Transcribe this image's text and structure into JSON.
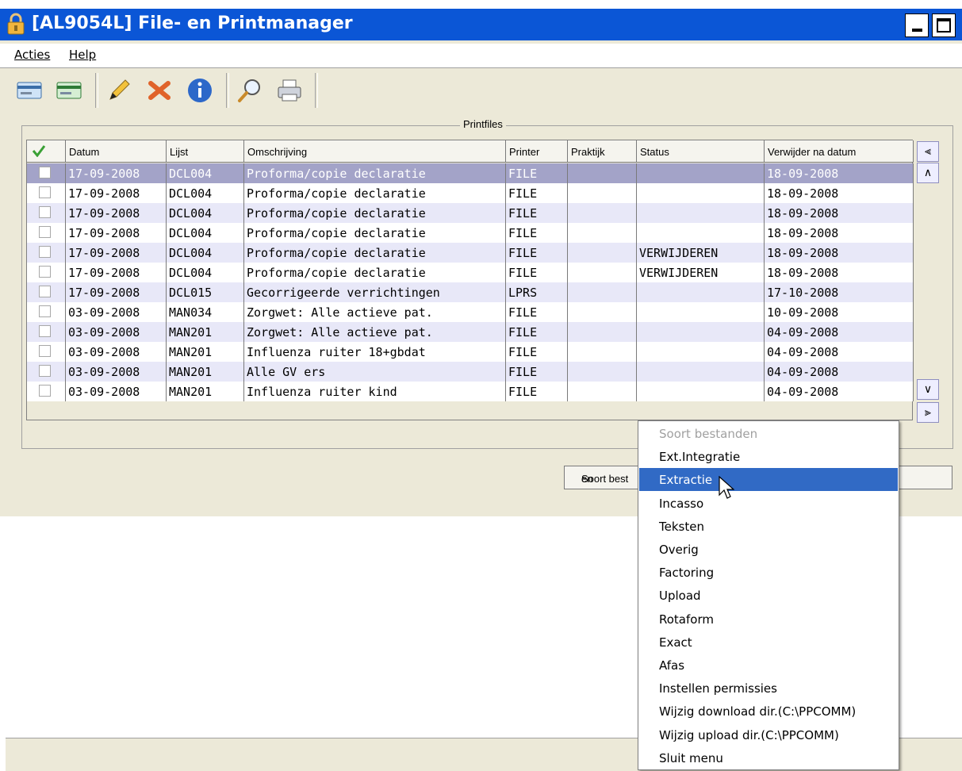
{
  "window": {
    "title": "[AL9054L] File- en Printmanager"
  },
  "menubar": {
    "items": [
      "Acties",
      "Help"
    ]
  },
  "toolbar": {
    "icons": [
      "card-icon",
      "card-green-icon",
      "pencil-icon",
      "delete-icon",
      "info-icon",
      "search-icon",
      "printer-icon"
    ]
  },
  "group": {
    "label": "Printfiles"
  },
  "grid": {
    "columns": [
      "",
      "Datum",
      "Lijst",
      "Omschrijving",
      "Printer",
      "Praktijk",
      "Status",
      "Verwijder na datum"
    ],
    "rows": [
      [
        "17-09-2008",
        "DCL004",
        "Proforma/copie declaratie",
        "FILE",
        "",
        "",
        "18-09-2008"
      ],
      [
        "17-09-2008",
        "DCL004",
        "Proforma/copie declaratie",
        "FILE",
        "",
        "",
        "18-09-2008"
      ],
      [
        "17-09-2008",
        "DCL004",
        "Proforma/copie declaratie",
        "FILE",
        "",
        "",
        "18-09-2008"
      ],
      [
        "17-09-2008",
        "DCL004",
        "Proforma/copie declaratie",
        "FILE",
        "",
        "",
        "18-09-2008"
      ],
      [
        "17-09-2008",
        "DCL004",
        "Proforma/copie declaratie",
        "FILE",
        "",
        "VERWIJDEREN",
        "18-09-2008"
      ],
      [
        "17-09-2008",
        "DCL004",
        "Proforma/copie declaratie",
        "FILE",
        "",
        "VERWIJDEREN",
        "18-09-2008"
      ],
      [
        "17-09-2008",
        "DCL015",
        "Gecorrigeerde verrichtingen",
        "LPRS",
        "",
        "",
        "17-10-2008"
      ],
      [
        "03-09-2008",
        "MAN034",
        "Zorgwet: Alle actieve pat.",
        "FILE",
        "",
        "",
        "10-09-2008"
      ],
      [
        "03-09-2008",
        "MAN201",
        "Zorgwet: Alle actieve pat.",
        "FILE",
        "",
        "",
        "04-09-2008"
      ],
      [
        "03-09-2008",
        "MAN201",
        "Influenza ruiter 18+gbdat",
        "FILE",
        "",
        "",
        "04-09-2008"
      ],
      [
        "03-09-2008",
        "MAN201",
        "Alle GV ers",
        "FILE",
        "",
        "",
        "04-09-2008"
      ],
      [
        "03-09-2008",
        "MAN201",
        "Influenza ruiter kind",
        "FILE",
        "",
        "",
        "04-09-2008"
      ]
    ]
  },
  "buttons": {
    "soort_left": "Soort best",
    "soort_right": "en"
  },
  "context_menu": {
    "items": [
      {
        "label": "Soort bestanden",
        "disabled": true
      },
      {
        "label": "Ext.Integratie"
      },
      {
        "label": "Extractie",
        "highlighted": true
      },
      {
        "label": "Incasso"
      },
      {
        "label": "Teksten"
      },
      {
        "label": "Overig"
      },
      {
        "label": "Factoring"
      },
      {
        "label": "Upload"
      },
      {
        "label": "Rotaform"
      },
      {
        "label": "Exact"
      },
      {
        "label": "Afas"
      },
      {
        "label": "Instellen permissies"
      },
      {
        "label": "Wijzig download dir.(C:\\PPCOMM)"
      },
      {
        "label": "Wijzig upload dir.(C:\\PPCOMM)"
      },
      {
        "label": "Sluit menu"
      }
    ]
  },
  "colors": {
    "titlebar": "#0b56d6",
    "highlight": "#316ac5",
    "selected_row": "#a3a3c8"
  }
}
